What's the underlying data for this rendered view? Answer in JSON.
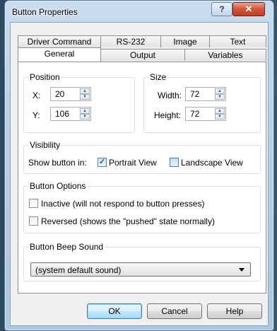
{
  "window": {
    "title": "Button Properties"
  },
  "tabs": {
    "row1": [
      "Driver Command",
      "RS-232",
      "Image",
      "Text"
    ],
    "row2": [
      "General",
      "Output",
      "Variables"
    ],
    "active": "General"
  },
  "position": {
    "legend": "Position",
    "x_label": "X:",
    "x_value": "20",
    "y_label": "Y:",
    "y_value": "106"
  },
  "size": {
    "legend": "Size",
    "width_label": "Width:",
    "width_value": "72",
    "height_label": "Height:",
    "height_value": "72"
  },
  "visibility": {
    "legend": "Visibility",
    "show_label": "Show button in:",
    "portrait_label": "Portrait View",
    "portrait_checked": true,
    "landscape_label": "Landscape View",
    "landscape_checked": false
  },
  "button_options": {
    "legend": "Button Options",
    "inactive_label": "Inactive (will not respond to button presses)",
    "inactive_checked": false,
    "reversed_label": "Reversed (shows the \"pushed\" state normally)",
    "reversed_checked": false
  },
  "beep": {
    "legend": "Button Beep Sound",
    "selected": "(system default sound)"
  },
  "footer": {
    "ok": "OK",
    "cancel": "Cancel",
    "help": "Help"
  },
  "titlebar": {
    "help_glyph": "?",
    "close_glyph": "✕"
  }
}
